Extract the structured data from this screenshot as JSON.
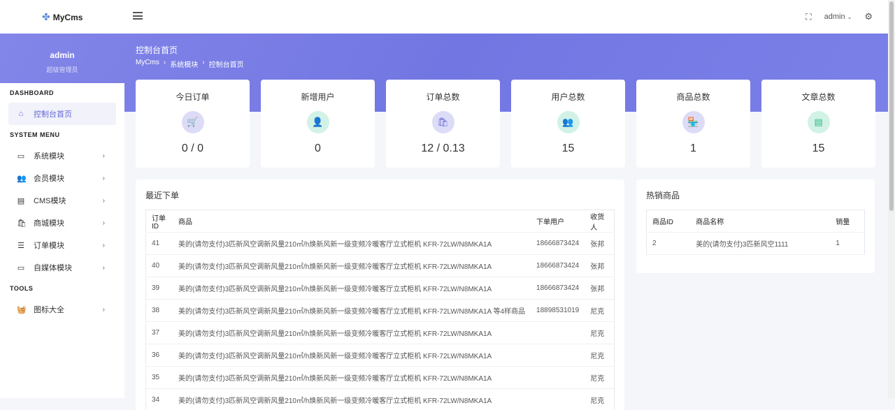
{
  "header": {
    "brand": "MyCms",
    "user": "admin"
  },
  "sidebar": {
    "user_name": "admin",
    "user_role": "超级管理员",
    "sections": [
      {
        "title": "DASHBOARD",
        "items": [
          {
            "label": "控制台首页",
            "icon": "home-icon",
            "active": true
          }
        ]
      },
      {
        "title": "SYSTEM MENU",
        "items": [
          {
            "label": "系统模块",
            "icon": "monitor-icon"
          },
          {
            "label": "会员模块",
            "icon": "users-icon"
          },
          {
            "label": "CMS模块",
            "icon": "document-icon"
          },
          {
            "label": "商城模块",
            "icon": "shopping-bag-icon"
          },
          {
            "label": "订单模块",
            "icon": "list-icon"
          },
          {
            "label": "自媒体模块",
            "icon": "video-icon"
          }
        ]
      },
      {
        "title": "TOOLS",
        "items": [
          {
            "label": "图标大全",
            "icon": "basket-icon"
          }
        ]
      }
    ]
  },
  "page": {
    "title": "控制台首页",
    "breadcrumb": [
      "MyCms",
      "系统模块",
      "控制台首页"
    ]
  },
  "stats": [
    {
      "label": "今日订单",
      "value": "0 / 0",
      "icon": "cart-icon",
      "bg": "#dcdcf7",
      "fg": "#6468d6"
    },
    {
      "label": "新增用户",
      "value": "0",
      "icon": "user-icon",
      "bg": "#d2f2e6",
      "fg": "#2fb888"
    },
    {
      "label": "订单总数",
      "value": "12 / 0.13",
      "icon": "bag-icon",
      "bg": "#dcdcf7",
      "fg": "#6468d6"
    },
    {
      "label": "用户总数",
      "value": "15",
      "icon": "users-icon",
      "bg": "#d2f2e6",
      "fg": "#2fb888"
    },
    {
      "label": "商品总数",
      "value": "1",
      "icon": "store-icon",
      "bg": "#dcdcf7",
      "fg": "#6468d6"
    },
    {
      "label": "文章总数",
      "value": "15",
      "icon": "document-icon",
      "bg": "#d2f2e6",
      "fg": "#2fb888"
    }
  ],
  "recent_orders": {
    "title": "最近下单",
    "columns": [
      "订单ID",
      "商品",
      "下单用户",
      "收货人"
    ],
    "rows": [
      [
        "41",
        "美的(请勿支付)3匹新风空调新风量210㎡/h焕新风新一级变频冷暖客厅立式柜机 KFR-72LW/N8MKA1A",
        "18666873424",
        "张邦"
      ],
      [
        "40",
        "美的(请勿支付)3匹新风空调新风量210㎡/h焕新风新一级变频冷暖客厅立式柜机 KFR-72LW/N8MKA1A",
        "18666873424",
        "张邦"
      ],
      [
        "39",
        "美的(请勿支付)3匹新风空调新风量210㎡/h焕新风新一级变频冷暖客厅立式柜机 KFR-72LW/N8MKA1A",
        "18666873424",
        "张邦"
      ],
      [
        "38",
        "美的(请勿支付)3匹新风空调新风量210㎡/h焕新风新一级变频冷暖客厅立式柜机 KFR-72LW/N8MKA1A 等4样商品",
        "18898531019",
        "尼克"
      ],
      [
        "37",
        "美的(请勿支付)3匹新风空调新风量210㎡/h焕新风新一级变频冷暖客厅立式柜机 KFR-72LW/N8MKA1A",
        "",
        "尼克"
      ],
      [
        "36",
        "美的(请勿支付)3匹新风空调新风量210㎡/h焕新风新一级变频冷暖客厅立式柜机 KFR-72LW/N8MKA1A",
        "",
        "尼克"
      ],
      [
        "35",
        "美的(请勿支付)3匹新风空调新风量210㎡/h焕新风新一级变频冷暖客厅立式柜机 KFR-72LW/N8MKA1A",
        "",
        "尼克"
      ],
      [
        "34",
        "美的(请勿支付)3匹新风空调新风量210㎡/h焕新风新一级变频冷暖客厅立式柜机 KFR-72LW/N8MKA1A",
        "",
        "尼克"
      ]
    ]
  },
  "hot_products": {
    "title": "热销商品",
    "columns": [
      "商品ID",
      "商品名称",
      "销量"
    ],
    "rows": [
      [
        "2",
        "美的(请勿支付)3匹新风空1111",
        "1"
      ]
    ]
  }
}
